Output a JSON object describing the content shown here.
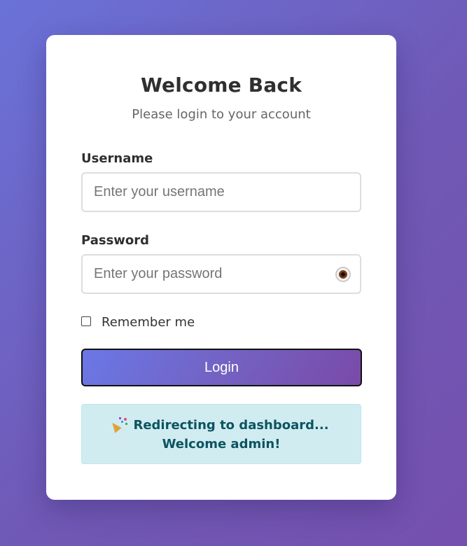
{
  "login": {
    "title": "Welcome Back",
    "subtitle": "Please login to your account",
    "username": {
      "label": "Username",
      "placeholder": "Enter your username",
      "value": ""
    },
    "password": {
      "label": "Password",
      "placeholder": "Enter your password",
      "value": "",
      "toggle_icon": "eye-icon"
    },
    "remember": {
      "label": "Remember me",
      "checked": false
    },
    "submit_label": "Login",
    "status_message": {
      "icon": "party-popper-icon",
      "text": "Redirecting to dashboard... Welcome admin!"
    }
  },
  "colors": {
    "background_start": "#6a72d8",
    "background_end": "#7550ae",
    "button_start": "#6a78e6",
    "button_end": "#7a4aa8",
    "alert_background": "#d1ecf1",
    "alert_text": "#0c5460"
  }
}
